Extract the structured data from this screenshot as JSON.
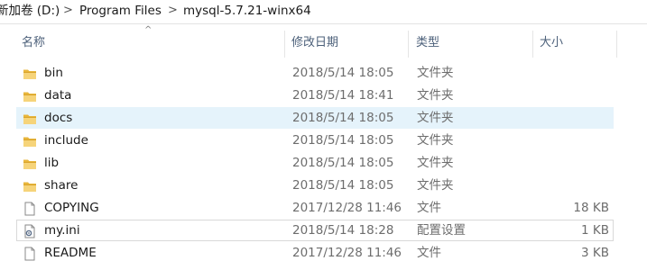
{
  "breadcrumb": {
    "items": [
      "新加卷 (D:)",
      "Program Files",
      "mysql-5.7.21-winx64"
    ],
    "separator": ">"
  },
  "columns": {
    "name": "名称",
    "date": "修改日期",
    "type": "类型",
    "size": "大小"
  },
  "files": [
    {
      "name": "bin",
      "date": "2018/5/14 18:05",
      "type": "文件夹",
      "size": "",
      "icon": "folder-icon"
    },
    {
      "name": "data",
      "date": "2018/5/14 18:41",
      "type": "文件夹",
      "size": "",
      "icon": "folder-icon"
    },
    {
      "name": "docs",
      "date": "2018/5/14 18:05",
      "type": "文件夹",
      "size": "",
      "icon": "folder-icon"
    },
    {
      "name": "include",
      "date": "2018/5/14 18:05",
      "type": "文件夹",
      "size": "",
      "icon": "folder-icon"
    },
    {
      "name": "lib",
      "date": "2018/5/14 18:05",
      "type": "文件夹",
      "size": "",
      "icon": "folder-icon"
    },
    {
      "name": "share",
      "date": "2018/5/14 18:05",
      "type": "文件夹",
      "size": "",
      "icon": "folder-icon"
    },
    {
      "name": "COPYING",
      "date": "2017/12/28 11:46",
      "type": "文件",
      "size": "18 KB",
      "icon": "file-icon"
    },
    {
      "name": "my.ini",
      "date": "2018/5/14 18:28",
      "type": "配置设置",
      "size": "1 KB",
      "icon": "settings-file-icon"
    },
    {
      "name": "README",
      "date": "2017/12/28 11:46",
      "type": "文件",
      "size": "3 KB",
      "icon": "file-icon"
    }
  ],
  "colors": {
    "folder": "#e8b53a",
    "selection": "#e5f3fb",
    "header_text": "#4c607a"
  }
}
